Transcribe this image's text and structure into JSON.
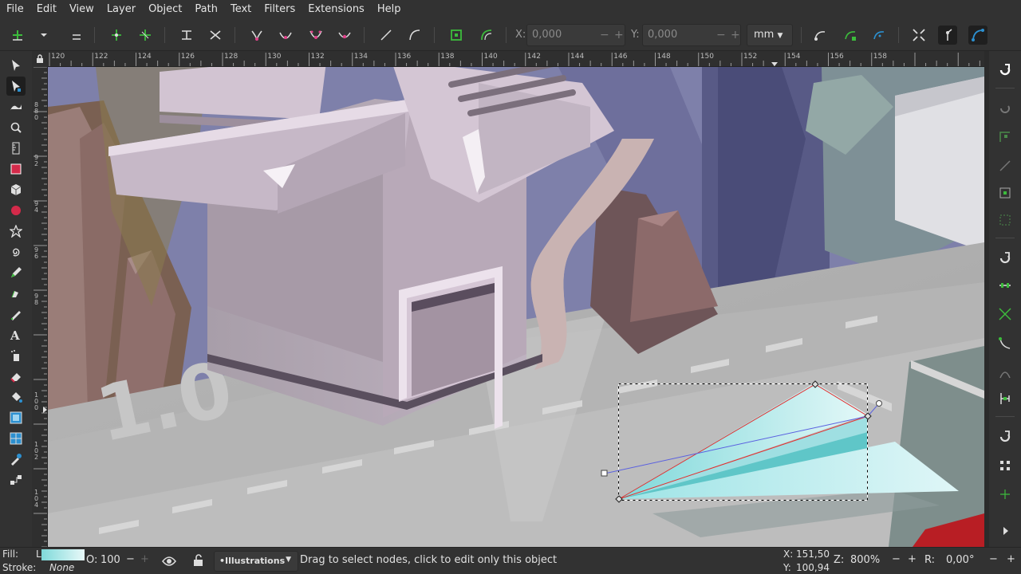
{
  "menu": [
    "File",
    "Edit",
    "View",
    "Layer",
    "Object",
    "Path",
    "Text",
    "Filters",
    "Extensions",
    "Help"
  ],
  "toolctrl": {
    "x_label": "X:",
    "x_value": "0,000",
    "y_label": "Y:",
    "y_value": "0,000",
    "unit": "mm",
    "minus": "−",
    "plus": "+"
  },
  "tools": [
    "selector-tool-icon",
    "node-tool-icon",
    "tweak-tool-icon",
    "zoom-tool-icon",
    "measure-tool-icon",
    "rectangle-tool-icon",
    "box3d-tool-icon",
    "ellipse-tool-icon",
    "star-tool-icon",
    "spiral-tool-icon",
    "pencil-tool-icon",
    "pen-tool-icon",
    "calligraphy-tool-icon",
    "text-tool-icon",
    "spray-tool-icon",
    "eraser-tool-icon",
    "bucket-tool-icon",
    "gradient-tool-icon",
    "mesh-tool-icon",
    "dropper-tool-icon",
    "connector-tool-icon"
  ],
  "ruler": {
    "h_labels": [
      "120",
      "122",
      "124",
      "126",
      "128",
      "130",
      "132",
      "134",
      "136",
      "138",
      "140",
      "142",
      "144",
      "146",
      "148",
      "150",
      "152",
      "154",
      "156",
      "158"
    ],
    "v_labels": [
      "8",
      "8",
      "0",
      "9",
      "2",
      "9",
      "4",
      "9",
      "6",
      "9",
      "8",
      "1",
      "0",
      "0",
      "1",
      "0",
      "2",
      "1",
      "0",
      "4"
    ]
  },
  "canvas_art": {
    "watermark_text": "1.0"
  },
  "status": {
    "fill_label": "Fill:",
    "fill_value": "L",
    "stroke_label": "Stroke:",
    "stroke_value": "None",
    "opacity_label": "O:",
    "opacity_value": "100",
    "layer": "•Illustrations",
    "message": "Drag to select nodes, click to edit only this object",
    "cursor_x_label": "X:",
    "cursor_x": "151,50",
    "cursor_y_label": "Y:",
    "cursor_y": "100,94",
    "zoom_label": "Z:",
    "zoom": "800%",
    "rotation_label": "R:",
    "rotation": "0,00°"
  },
  "colors": {
    "accent": "#2c90d0",
    "node_green": "#3cbc3c",
    "node_pink": "#e0408a",
    "path_red": "#e03030",
    "plane": "#bfeef0"
  }
}
